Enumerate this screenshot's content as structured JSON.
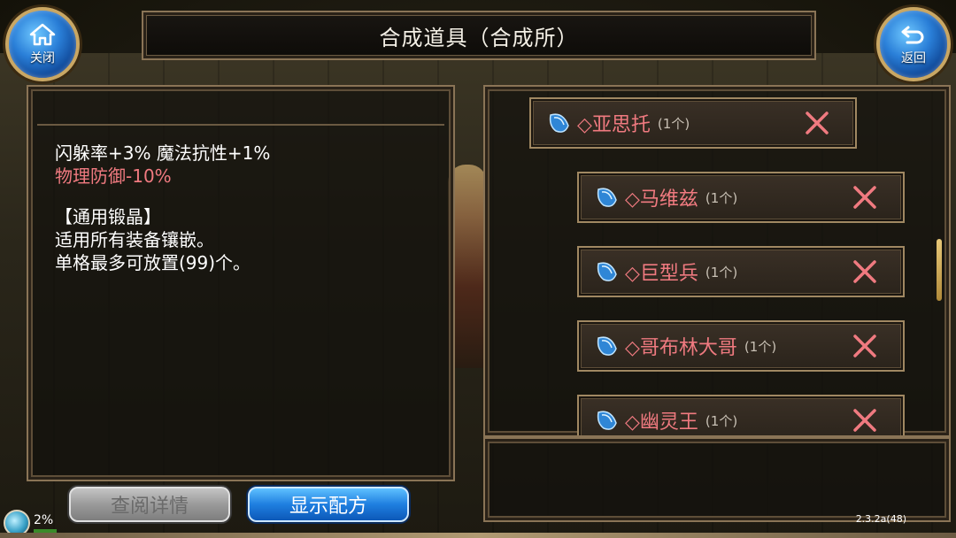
{
  "header": {
    "title": "合成道具（合成所）",
    "close_label": "关闭",
    "back_label": "返回",
    "close_icon": "home-icon",
    "back_icon": "return-arrow-icon"
  },
  "description": {
    "stats_line": "闪躲率+3% 魔法抗性+1%",
    "penalty_line": "物理防御-10%",
    "category": "【通用锻晶】",
    "usage": "适用所有装备镶嵌。",
    "stack": "单格最多可放置(99)个。"
  },
  "materials": [
    {
      "name": "◇亚思托",
      "qty": "(1个)",
      "icon": "blue-gem-icon"
    },
    {
      "name": "◇马维兹",
      "qty": "(1个)",
      "icon": "blue-gem-icon"
    },
    {
      "name": "◇巨型兵",
      "qty": "(1个)",
      "icon": "blue-gem-icon"
    },
    {
      "name": "◇哥布林大哥",
      "qty": "(1个)",
      "icon": "blue-gem-icon"
    },
    {
      "name": "◇幽灵王",
      "qty": "(1个)",
      "icon": "blue-gem-icon"
    }
  ],
  "buttons": {
    "detail": "查阅详情",
    "recipe": "显示配方"
  },
  "status": {
    "percent": "2%",
    "version": "2.3.2a(48)"
  },
  "colors": {
    "accent_red": "#f07a80",
    "button_blue": "#1f7fe0",
    "frame_gold": "#8a7456"
  }
}
